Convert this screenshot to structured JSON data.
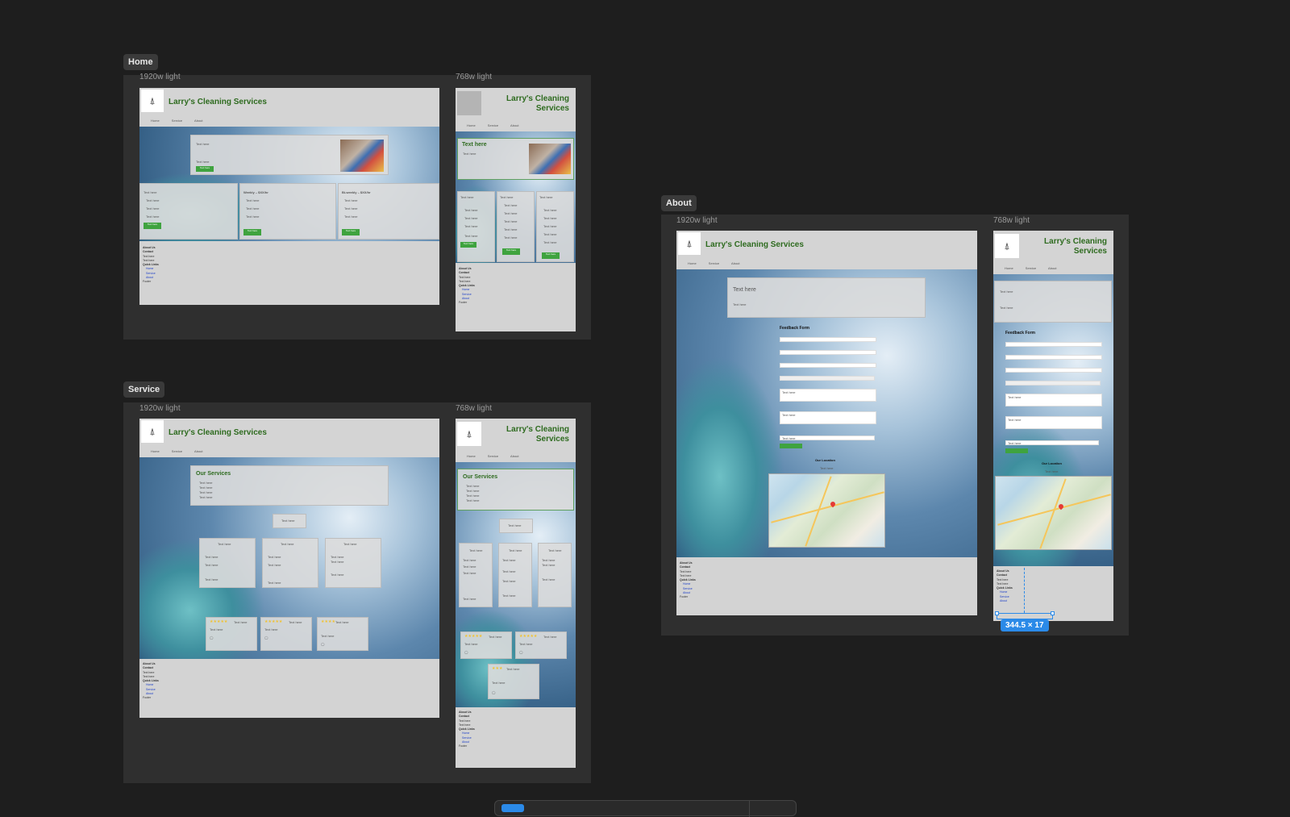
{
  "sections": {
    "home": {
      "label": "Home"
    },
    "service": {
      "label": "Service"
    },
    "about": {
      "label": "About"
    }
  },
  "frames": {
    "desktop": "1920w light",
    "tablet": "768w light"
  },
  "site": {
    "name": "Larry's Cleaning Services",
    "name_line1": "Larry's Cleaning",
    "name_line2": "Services",
    "nav": [
      "Home",
      "Service",
      "About"
    ]
  },
  "placeholder": "Text here",
  "home": {
    "plan_titles": [
      "Text here",
      "Weekly – $XX/hr",
      "Bi-weekly – $XX/hr"
    ]
  },
  "service": {
    "title": "Our Services"
  },
  "about": {
    "form_title": "Feedback Form",
    "location_title": "Our Location"
  },
  "footer": {
    "about": "About Us",
    "contact": "Contact",
    "quick_links": "Quick Links",
    "links": [
      "Home",
      "Service",
      "About"
    ],
    "copyright": "Footer"
  },
  "selection": {
    "dimensions": "344.5 × 17"
  },
  "colors": {
    "brand_green": "#2e6b1f",
    "button_green": "#3fa33f",
    "selection_blue": "#2b8ae8",
    "canvas": "#1e1e1e"
  }
}
